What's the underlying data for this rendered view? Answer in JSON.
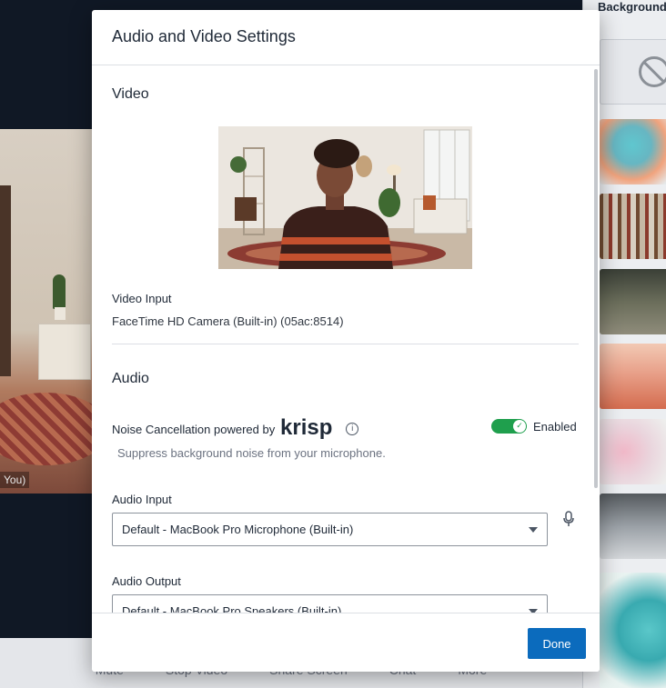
{
  "background_app": {
    "participant_name": "You)",
    "toolbar_items": [
      "Mute",
      "Stop Video",
      "Share Screen",
      "Chat",
      "More"
    ],
    "backgrounds_panel_title": "Background"
  },
  "modal": {
    "title": "Audio and Video Settings",
    "video": {
      "section_title": "Video",
      "input_label": "Video Input",
      "input_value": "FaceTime HD Camera (Built-in) (05ac:8514)"
    },
    "audio": {
      "section_title": "Audio",
      "noise_cancellation_label": "Noise Cancellation powered by",
      "krisp_logo_text": "krisp",
      "noise_toggle_state": "Enabled",
      "noise_toggle_on": true,
      "noise_helper": "Suppress background noise from your microphone.",
      "input_label": "Audio Input",
      "input_value": "Default - MacBook Pro Microphone (Built-in)",
      "output_label": "Audio Output",
      "output_value": "Default - MacBook Pro Speakers (Built-in)"
    },
    "done_label": "Done"
  },
  "colors": {
    "accent_blue": "#0b6bbd",
    "toggle_green": "#1f9f4d",
    "dark_background": "#101825"
  },
  "icons": [
    "info-icon",
    "checkmark-icon",
    "chevron-down-icon",
    "microphone-icon",
    "no-background-icon"
  ]
}
